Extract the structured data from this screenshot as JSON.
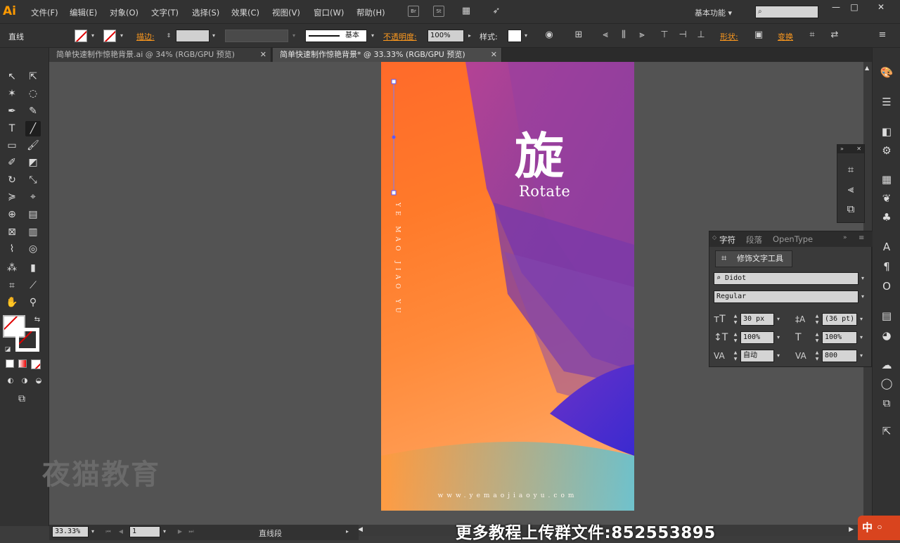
{
  "app": {
    "logo": "Ai",
    "accent": "#ff9a00"
  },
  "menu": [
    "文件(F)",
    "编辑(E)",
    "对象(O)",
    "文字(T)",
    "选择(S)",
    "效果(C)",
    "视图(V)",
    "窗口(W)",
    "帮助(H)"
  ],
  "menubar_buttons": {
    "bridge": "Br",
    "stock": "St"
  },
  "workspace": {
    "label": "基本功能",
    "search_placeholder": ""
  },
  "window_controls": {
    "minimize": "—",
    "restore": "□",
    "close": "✕"
  },
  "control_bar": {
    "object_type": "直线",
    "stroke_label": "描边:",
    "stroke_style": "基本",
    "opacity_label": "不透明度:",
    "opacity_value": "100%",
    "style_label": "样式:",
    "shape_label": "形状:",
    "transform_label": "变换"
  },
  "tabs": [
    {
      "label": "简单快速制作惊艳背景.ai @ 34% (RGB/GPU 预览)",
      "active": false
    },
    {
      "label": "简单快速制作惊艳背景* @ 33.33% (RGB/GPU 预览)",
      "active": true
    }
  ],
  "artwork": {
    "title_cn": "旋",
    "title_en": "Rotate",
    "vertical_text": "YE MAO JIAO YU",
    "url": "www.yemaojiaoyu.com"
  },
  "watermark": "夜猫教育",
  "status_bar": {
    "zoom": "33.33%",
    "artboard": "1",
    "tool": "直线段"
  },
  "subtitle": "更多教程上传群文件:852553895",
  "character_panel": {
    "tabs": [
      "字符",
      "段落",
      "OpenType"
    ],
    "touchup_button": "修饰文字工具",
    "font_family": "Didot",
    "font_style": "Regular",
    "font_size": "30 px",
    "leading": "(36 pt)",
    "vertical_scale": "100%",
    "horizontal_scale": "100%",
    "kerning": "自动",
    "tracking": "800"
  },
  "ime_badge": "中 ◦"
}
